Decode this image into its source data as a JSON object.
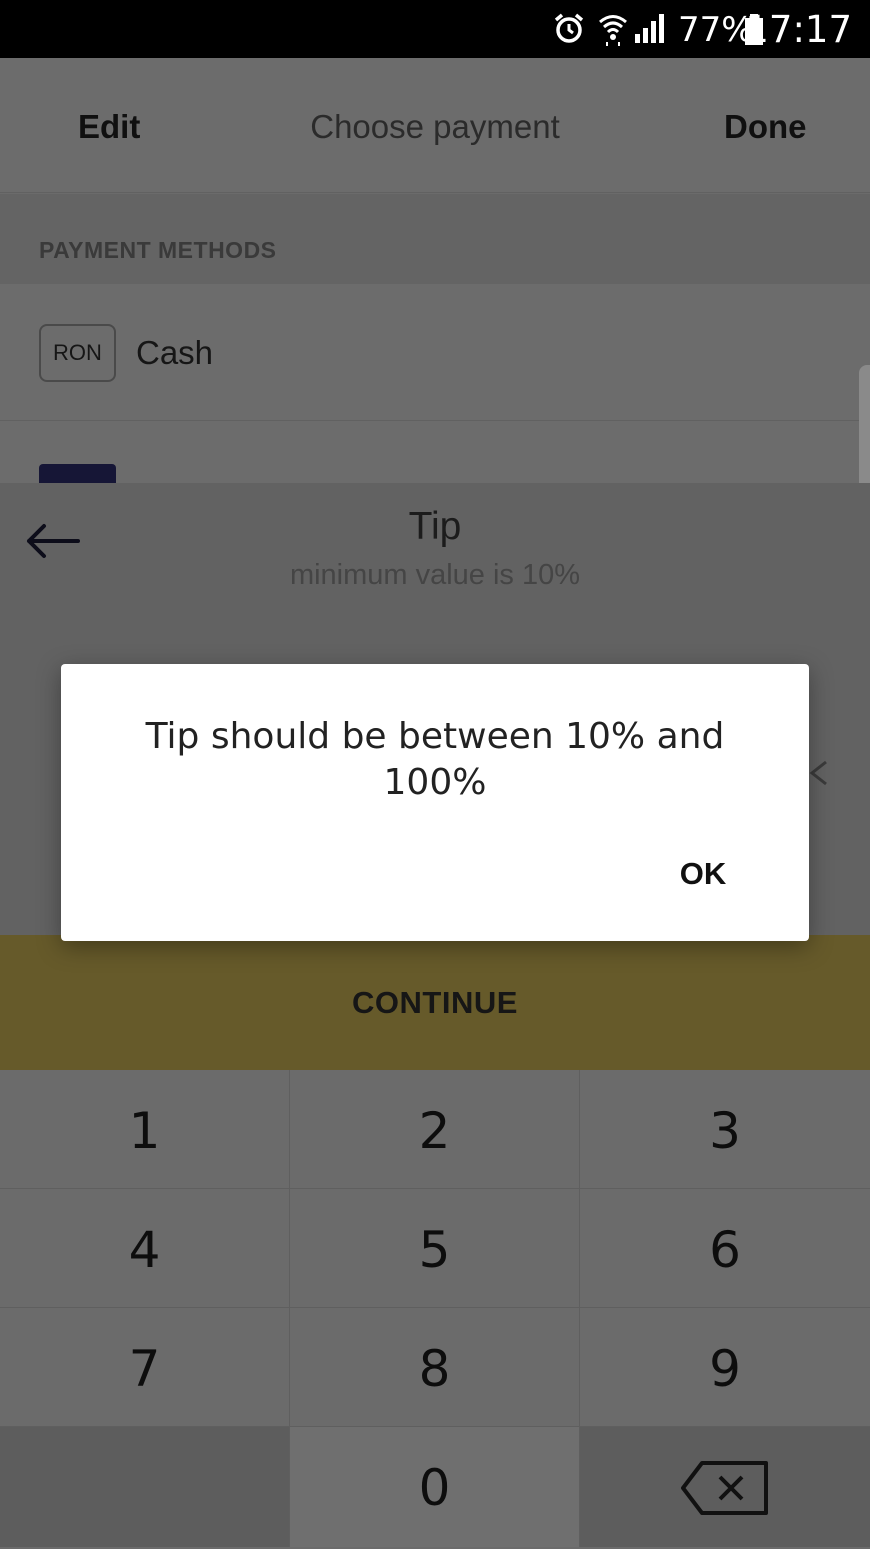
{
  "status_bar": {
    "battery": "77%",
    "time": "17:17",
    "icons": [
      "alarm-icon",
      "wifi-icon",
      "signal-icon",
      "battery-icon"
    ]
  },
  "header": {
    "edit": "Edit",
    "title": "Choose payment",
    "done": "Done"
  },
  "payment_methods": {
    "section_label": "PAYMENT METHODS",
    "cash": {
      "badge": "RON",
      "label": "Cash"
    }
  },
  "tip": {
    "title": "Tip",
    "subtitle": "minimum value is 10%"
  },
  "continue_label": "CONTINUE",
  "keypad": {
    "keys": [
      "1",
      "2",
      "3",
      "4",
      "5",
      "6",
      "7",
      "8",
      "9",
      "0"
    ]
  },
  "dialog": {
    "message": "Tip should be between 10% and 100%",
    "ok": "OK"
  },
  "colors": {
    "accent": "#e6c84a",
    "overlay_dim": "#6b6b6b"
  }
}
